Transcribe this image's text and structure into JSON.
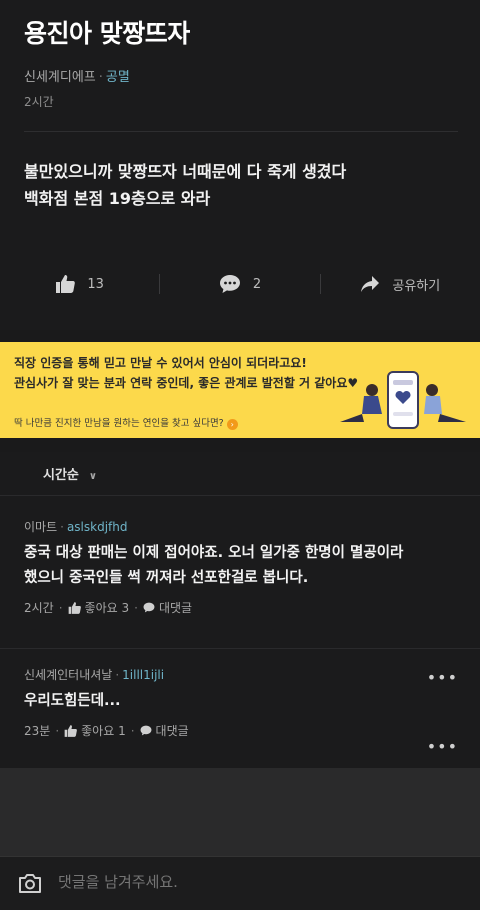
{
  "post": {
    "title": "용진아 맞짱뜨자",
    "company": "신세계디에프",
    "job": "공멸",
    "time": "2시간",
    "body_line1": "불만있으니까 맞짱뜨자 너때문에 다 죽게 생겼다",
    "body_line2": "백화점 본점 19층으로 와라",
    "likes": "13",
    "comments": "2",
    "share_label": "공유하기"
  },
  "banner": {
    "line1": "직장 인증을 통해 믿고 만날 수 있어서 안심이 되더라고요!",
    "line2": "관심사가 잘 맞는 분과 연락 중인데, 좋은 관계로 발전할 거 같아요♥",
    "line3": "딱 나만큼 진지한 만남을 원하는 연인을 찾고 싶다면?",
    "bg_color": "#fcd94b"
  },
  "sort": {
    "label": "시간순"
  },
  "comments": [
    {
      "company": "이마트",
      "user": "aslskdjfhd",
      "text_line1": "중국 대상 판매는 이제 접어야죠. 오너 일가중 한명이 멸공이라",
      "text_line2": "했으니 중국인들 썩 꺼져라 선포한걸로 봅니다.",
      "time": "2시간",
      "like_label": "좋아요 3",
      "reply_label": "대댓글"
    },
    {
      "company": "신세계인터내셔날",
      "user": "1illl1ijli",
      "text_line1": "우리도힘든데...",
      "time": "23분",
      "like_label": "좋아요 1",
      "reply_label": "대댓글"
    }
  ],
  "input": {
    "placeholder": "댓글을 남겨주세요."
  },
  "colors": {
    "accent": "#6fb4c8",
    "background": "#1b1b1c"
  }
}
